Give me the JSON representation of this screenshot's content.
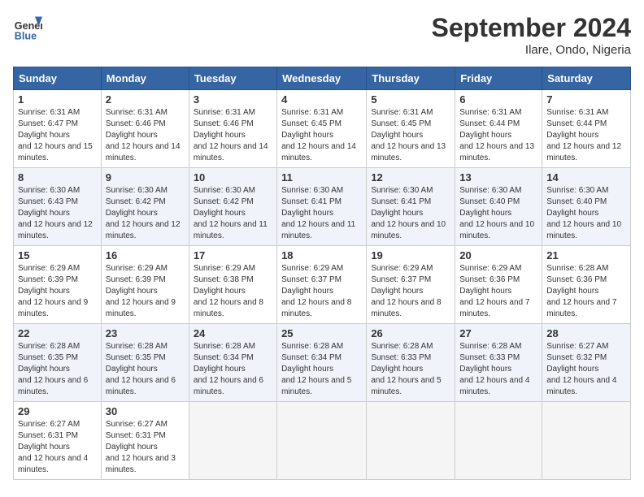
{
  "header": {
    "logo_line1": "General",
    "logo_line2": "Blue",
    "month_year": "September 2024",
    "location": "Ilare, Ondo, Nigeria"
  },
  "weekdays": [
    "Sunday",
    "Monday",
    "Tuesday",
    "Wednesday",
    "Thursday",
    "Friday",
    "Saturday"
  ],
  "weeks": [
    [
      {
        "num": "1",
        "sunrise": "6:31 AM",
        "sunset": "6:47 PM",
        "daylight": "12 hours and 15 minutes."
      },
      {
        "num": "2",
        "sunrise": "6:31 AM",
        "sunset": "6:46 PM",
        "daylight": "12 hours and 14 minutes."
      },
      {
        "num": "3",
        "sunrise": "6:31 AM",
        "sunset": "6:46 PM",
        "daylight": "12 hours and 14 minutes."
      },
      {
        "num": "4",
        "sunrise": "6:31 AM",
        "sunset": "6:45 PM",
        "daylight": "12 hours and 14 minutes."
      },
      {
        "num": "5",
        "sunrise": "6:31 AM",
        "sunset": "6:45 PM",
        "daylight": "12 hours and 13 minutes."
      },
      {
        "num": "6",
        "sunrise": "6:31 AM",
        "sunset": "6:44 PM",
        "daylight": "12 hours and 13 minutes."
      },
      {
        "num": "7",
        "sunrise": "6:31 AM",
        "sunset": "6:44 PM",
        "daylight": "12 hours and 12 minutes."
      }
    ],
    [
      {
        "num": "8",
        "sunrise": "6:30 AM",
        "sunset": "6:43 PM",
        "daylight": "12 hours and 12 minutes."
      },
      {
        "num": "9",
        "sunrise": "6:30 AM",
        "sunset": "6:42 PM",
        "daylight": "12 hours and 12 minutes."
      },
      {
        "num": "10",
        "sunrise": "6:30 AM",
        "sunset": "6:42 PM",
        "daylight": "12 hours and 11 minutes."
      },
      {
        "num": "11",
        "sunrise": "6:30 AM",
        "sunset": "6:41 PM",
        "daylight": "12 hours and 11 minutes."
      },
      {
        "num": "12",
        "sunrise": "6:30 AM",
        "sunset": "6:41 PM",
        "daylight": "12 hours and 10 minutes."
      },
      {
        "num": "13",
        "sunrise": "6:30 AM",
        "sunset": "6:40 PM",
        "daylight": "12 hours and 10 minutes."
      },
      {
        "num": "14",
        "sunrise": "6:30 AM",
        "sunset": "6:40 PM",
        "daylight": "12 hours and 10 minutes."
      }
    ],
    [
      {
        "num": "15",
        "sunrise": "6:29 AM",
        "sunset": "6:39 PM",
        "daylight": "12 hours and 9 minutes."
      },
      {
        "num": "16",
        "sunrise": "6:29 AM",
        "sunset": "6:39 PM",
        "daylight": "12 hours and 9 minutes."
      },
      {
        "num": "17",
        "sunrise": "6:29 AM",
        "sunset": "6:38 PM",
        "daylight": "12 hours and 8 minutes."
      },
      {
        "num": "18",
        "sunrise": "6:29 AM",
        "sunset": "6:37 PM",
        "daylight": "12 hours and 8 minutes."
      },
      {
        "num": "19",
        "sunrise": "6:29 AM",
        "sunset": "6:37 PM",
        "daylight": "12 hours and 8 minutes."
      },
      {
        "num": "20",
        "sunrise": "6:29 AM",
        "sunset": "6:36 PM",
        "daylight": "12 hours and 7 minutes."
      },
      {
        "num": "21",
        "sunrise": "6:28 AM",
        "sunset": "6:36 PM",
        "daylight": "12 hours and 7 minutes."
      }
    ],
    [
      {
        "num": "22",
        "sunrise": "6:28 AM",
        "sunset": "6:35 PM",
        "daylight": "12 hours and 6 minutes."
      },
      {
        "num": "23",
        "sunrise": "6:28 AM",
        "sunset": "6:35 PM",
        "daylight": "12 hours and 6 minutes."
      },
      {
        "num": "24",
        "sunrise": "6:28 AM",
        "sunset": "6:34 PM",
        "daylight": "12 hours and 6 minutes."
      },
      {
        "num": "25",
        "sunrise": "6:28 AM",
        "sunset": "6:34 PM",
        "daylight": "12 hours and 5 minutes."
      },
      {
        "num": "26",
        "sunrise": "6:28 AM",
        "sunset": "6:33 PM",
        "daylight": "12 hours and 5 minutes."
      },
      {
        "num": "27",
        "sunrise": "6:28 AM",
        "sunset": "6:33 PM",
        "daylight": "12 hours and 4 minutes."
      },
      {
        "num": "28",
        "sunrise": "6:27 AM",
        "sunset": "6:32 PM",
        "daylight": "12 hours and 4 minutes."
      }
    ],
    [
      {
        "num": "29",
        "sunrise": "6:27 AM",
        "sunset": "6:31 PM",
        "daylight": "12 hours and 4 minutes."
      },
      {
        "num": "30",
        "sunrise": "6:27 AM",
        "sunset": "6:31 PM",
        "daylight": "12 hours and 3 minutes."
      },
      null,
      null,
      null,
      null,
      null
    ]
  ]
}
